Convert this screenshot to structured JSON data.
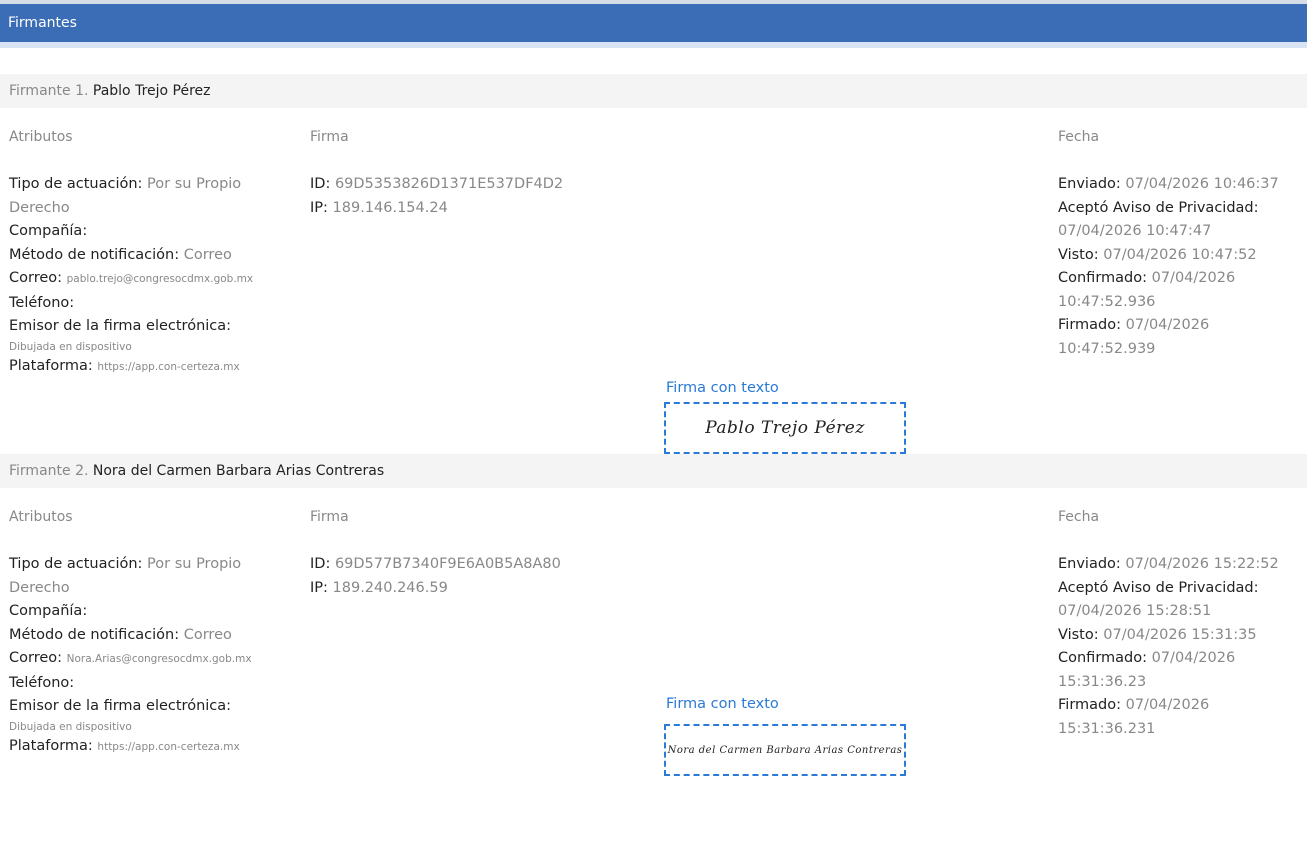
{
  "header": {
    "title": "Firmantes"
  },
  "columns": {
    "attributes": "Atributos",
    "signature": "Firma",
    "date": "Fecha"
  },
  "labels": {
    "tipo": "Tipo de actuación:",
    "compania": "Compañía:",
    "metodo": "Método de notificación:",
    "correo": "Correo:",
    "telefono": "Teléfono:",
    "emisor": "Emisor de la firma electrónica:",
    "plataforma": "Plataforma:",
    "id": "ID:",
    "ip": "IP:",
    "enviado": "Enviado:",
    "acepto": "Aceptó Aviso de Privacidad:",
    "visto": "Visto:",
    "confirmado": "Confirmado:",
    "firmado": "Firmado:",
    "firma_con_texto": "Firma con texto"
  },
  "signers": [
    {
      "prefix": "Firmante 1.",
      "name": "Pablo Trejo Pérez",
      "tipo": "Por su Propio Derecho",
      "compania": "",
      "metodo": "Correo",
      "correo": "pablo.trejo@congresocdmx.gob.mx",
      "telefono": "",
      "emisor": "Dibujada en dispositivo",
      "plataforma": "https://app.con-certeza.mx",
      "id": "69D5353826D1371E537DF4D2",
      "ip": "189.146.154.24",
      "signature_text": "Pablo Trejo Pérez",
      "enviado": "07/04/2026 10:46:37",
      "acepto": "07/04/2026 10:47:47",
      "visto": "07/04/2026 10:47:52",
      "confirmado": "07/04/2026 10:47:52.936",
      "firmado": "07/04/2026 10:47:52.939"
    },
    {
      "prefix": "Firmante 2.",
      "name": "Nora del Carmen Barbara Arias Contreras",
      "tipo": "Por su Propio Derecho",
      "compania": "",
      "metodo": "Correo",
      "correo": "Nora.Arias@congresocdmx.gob.mx",
      "telefono": "",
      "emisor": "Dibujada en dispositivo",
      "plataforma": "https://app.con-certeza.mx",
      "id": "69D577B7340F9E6A0B5A8A80",
      "ip": "189.240.246.59",
      "signature_text": "Nora del Carmen Barbara Arias Contreras",
      "enviado": "07/04/2026 15:22:52",
      "acepto": "07/04/2026 15:28:51",
      "visto": "07/04/2026 15:31:35",
      "confirmado": "07/04/2026 15:31:36.23",
      "firmado": "07/04/2026 15:31:36.231"
    }
  ],
  "colors": {
    "header_bg": "#3a6db5",
    "accent": "#2a7ad6",
    "muted": "#888888"
  }
}
